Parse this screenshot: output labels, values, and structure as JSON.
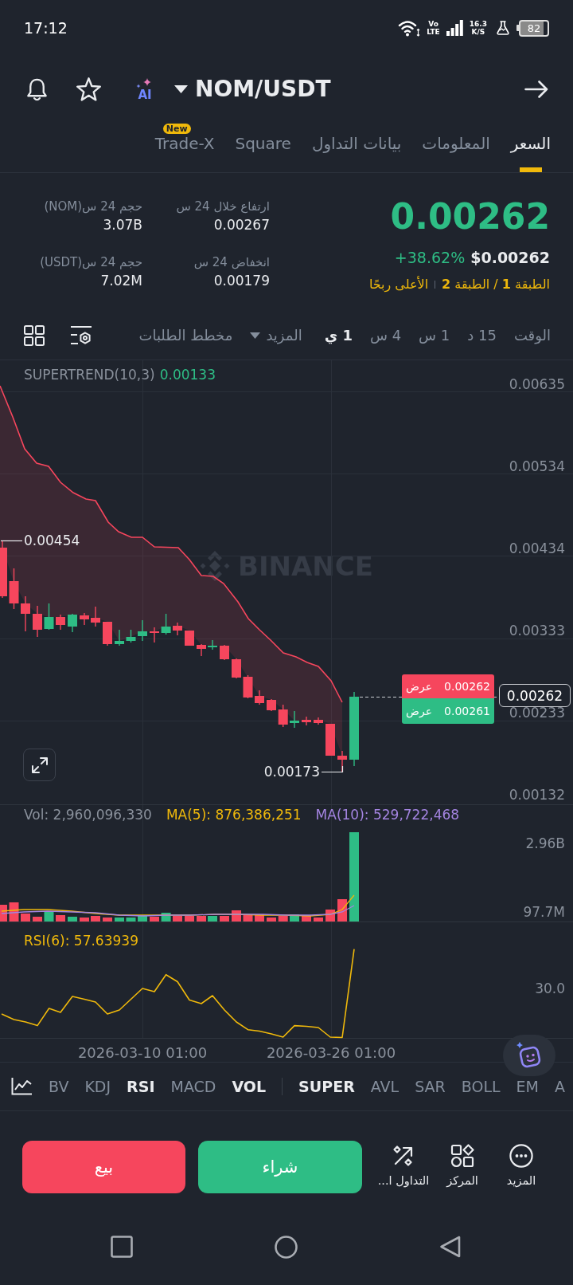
{
  "status_bar": {
    "time": "17:12",
    "network": [
      "Vo",
      "LTE"
    ],
    "speed": {
      "value": "16.3",
      "unit": "K/S"
    },
    "battery": "82"
  },
  "header": {
    "ai_label": "AI",
    "pair": "NOM/USDT"
  },
  "tabs": [
    {
      "label": "السعر",
      "selected": true
    },
    {
      "label": "المعلومات",
      "selected": false
    },
    {
      "label": "بيانات التداول",
      "selected": false
    },
    {
      "label": "Square",
      "selected": false
    },
    {
      "label": "Trade-X",
      "selected": false,
      "badge": "New"
    }
  ],
  "summary": {
    "price": "0.00262",
    "change": "+38.62%",
    "price_usd": "$0.00262",
    "tiers": "الطبقة **1** / الطبقة **2**",
    "tag": "الأعلى ربحًا",
    "stats": [
      {
        "label": "ارتفاع خلال 24 س",
        "value": "0.00267"
      },
      {
        "label": "حجم 24 س(NOM)",
        "value": "3.07B"
      },
      {
        "label": "انخفاض 24 س",
        "value": "0.00179"
      },
      {
        "label": "حجم 24 س(USDT)",
        "value": "7.02M"
      }
    ]
  },
  "intervals": {
    "label": "الوقت",
    "items": [
      {
        "label": "15 د",
        "selected": false
      },
      {
        "label": "1 س",
        "selected": false
      },
      {
        "label": "4 س",
        "selected": false
      },
      {
        "label": "1 ي",
        "selected": true
      }
    ],
    "more": "المزيد",
    "depth_chart": "مخطط الطلبات"
  },
  "chart": {
    "indicator": "SUPERTREND(10,3)",
    "indicator_value": "0.00133",
    "watermark": "BINANCE",
    "y_labels": [
      "0.00635",
      "0.00534",
      "0.00434",
      "0.00333",
      "0.00233",
      "0.00132"
    ],
    "high_label": "0.00454",
    "low_label": "0.00173",
    "ask": {
      "label": "عرض",
      "value": "0.00262"
    },
    "bid": {
      "label": "عرض",
      "value": "0.00261"
    },
    "last_price": "0.00262"
  },
  "volume": {
    "vol": "Vol: 2,960,096,330",
    "ma5": "MA(5): 876,386,251",
    "ma10": "MA(10): 529,722,468",
    "y_labels": [
      "2.96B",
      "97.7M"
    ]
  },
  "rsi": {
    "label": "RSI(6): 57.63939",
    "y_labels": [
      "30.0"
    ]
  },
  "x_labels": [
    "2026-03-26 01:00",
    "2026-03-10 01:00"
  ],
  "indicators": {
    "main": [
      {
        "label": "A",
        "selected": false
      },
      {
        "label": "EM",
        "selected": false
      },
      {
        "label": "BOLL",
        "selected": false
      },
      {
        "label": "SAR",
        "selected": false
      },
      {
        "label": "AVL",
        "selected": false
      },
      {
        "label": "SUPER",
        "selected": true
      }
    ],
    "sub": [
      {
        "label": "VOL",
        "selected": true
      },
      {
        "label": "MACD",
        "selected": false
      },
      {
        "label": "RSI",
        "selected": true
      },
      {
        "label": "KDJ",
        "selected": false
      },
      {
        "label": "BV",
        "selected": false
      }
    ]
  },
  "actions": {
    "sell": "بيع",
    "buy": "شراء",
    "tools": [
      {
        "kind": "more",
        "label": "المزيد"
      },
      {
        "kind": "position",
        "label": "المركز"
      },
      {
        "kind": "trade",
        "label": "التداول ا..."
      }
    ]
  }
}
